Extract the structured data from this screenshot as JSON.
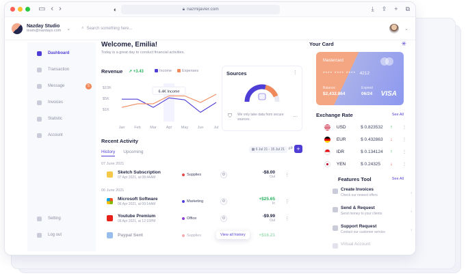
{
  "browser": {
    "url": "nazmijavier.com"
  },
  "header": {
    "studio_name": "Nazday Studio",
    "studio_email": "team@nazdays.com",
    "search_placeholder": "Search something here..."
  },
  "sidebar": {
    "items": [
      {
        "label": "Dashboard",
        "active": true
      },
      {
        "label": "Transaction"
      },
      {
        "label": "Message",
        "badge": "5"
      },
      {
        "label": "Invoices"
      },
      {
        "label": "Statistic"
      },
      {
        "label": "Account"
      }
    ],
    "bottom": [
      {
        "label": "Setting"
      },
      {
        "label": "Log out"
      }
    ]
  },
  "main": {
    "welcome": "Welcome, Emilia!",
    "subtitle": "Today is a great day to conduct financial activities.",
    "revenue": {
      "title": "Revenue",
      "change": "+3.43",
      "legend_income": "Income",
      "legend_expenses": "Expenses",
      "tooltip": "6.4K Income"
    },
    "sources": {
      "title": "Sources",
      "note": "We only take data from secure sources."
    },
    "activity": {
      "title": "Recent Activity",
      "tabs": [
        "History",
        "Upcoming"
      ],
      "date_range": "6 Jul 21 - 15 Jul 21",
      "groups": [
        {
          "date": "07 June 2021",
          "rows": [
            {
              "name": "Sketch Subscription",
              "time": "07 Apr 2021, at 08:44AM",
              "category": "Supplies",
              "amount": "-$8.00",
              "direction": "Out"
            }
          ]
        },
        {
          "date": "06 June 2021",
          "rows": [
            {
              "name": "Microsoft Software",
              "time": "06 Apr 2021, at 09:14AM",
              "category": "Marketing",
              "amount": "+$25.65",
              "direction": "In"
            },
            {
              "name": "Youtube Premium",
              "time": "06 Apr 2021, at 12:15PM",
              "category": "Office",
              "amount": "-$9.99",
              "direction": "Out"
            },
            {
              "name": "Paypal Sent",
              "time": "",
              "category": "Supplies",
              "amount": "+$16.21",
              "direction": ""
            }
          ]
        }
      ],
      "view_all": "View all history"
    }
  },
  "card": {
    "title": "Your Card",
    "brand": "Mastercard",
    "number_masked": "**** **** ****",
    "number_last": "4212",
    "balance_label": "Balance",
    "balance_value": "$2,432.864",
    "expired_label": "Expired",
    "expired_value": "06/24",
    "network": "VISA"
  },
  "exchange": {
    "title": "Exchange Rate",
    "see_all": "See All",
    "rows": [
      {
        "code": "USD",
        "value": "$ 0.823532",
        "trend": "up"
      },
      {
        "code": "EUR",
        "value": "$ 0.432863",
        "trend": "down"
      },
      {
        "code": "IDR",
        "value": "$ 0.134124",
        "trend": "up"
      },
      {
        "code": "YEN",
        "value": "$ 0.24325",
        "trend": "down"
      }
    ]
  },
  "features": {
    "title": "Features Tool",
    "see_all": "See All",
    "items": [
      {
        "title": "Create Invoices",
        "desc": "Check our newest offers"
      },
      {
        "title": "Send & Request",
        "desc": "Send money to your clients"
      },
      {
        "title": "Support Request",
        "desc": "Contact our customer service"
      },
      {
        "title": "Virtual Account",
        "desc": ""
      }
    ]
  },
  "chart_data": {
    "type": "line",
    "categories": [
      "Jan",
      "Feb",
      "Mar",
      "Apr",
      "May",
      "Jun",
      "Jul"
    ],
    "y_ticks": [
      "$10K",
      "$5K",
      "$1K"
    ],
    "ylim": [
      0,
      10
    ],
    "series": [
      {
        "name": "Income",
        "color": "#4f3ed6",
        "values": [
          6.0,
          6.0,
          3.5,
          6.4,
          5.8,
          2.0,
          5.0
        ]
      },
      {
        "name": "Expenses",
        "color": "#f08a5d",
        "values": [
          3.5,
          4.6,
          4.6,
          7.0,
          7.0,
          5.0,
          7.5
        ]
      }
    ]
  },
  "colors": {
    "accent": "#4f3ed6",
    "orange": "#f08a5d",
    "green": "#29b35f",
    "red": "#e5484d"
  }
}
